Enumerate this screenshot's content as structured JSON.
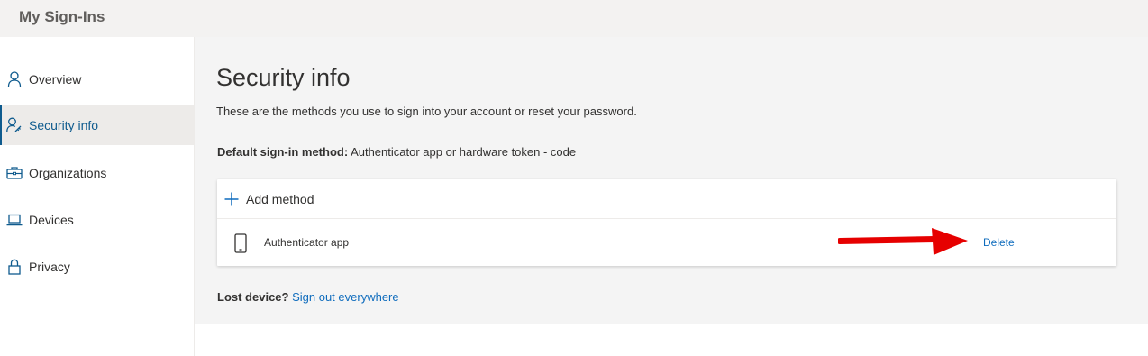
{
  "app": {
    "title": "My Sign-Ins"
  },
  "sidebar": {
    "items": [
      {
        "label": "Overview",
        "icon": "person-icon"
      },
      {
        "label": "Security info",
        "icon": "person-key-icon",
        "active": true
      },
      {
        "label": "Organizations",
        "icon": "briefcase-icon"
      },
      {
        "label": "Devices",
        "icon": "laptop-icon"
      },
      {
        "label": "Privacy",
        "icon": "lock-icon"
      }
    ]
  },
  "main": {
    "title": "Security info",
    "description": "These are the methods you use to sign into your account or reset your password.",
    "default_method": {
      "label": "Default sign-in method:",
      "value": " Authenticator app or hardware token - code"
    },
    "add_method_label": "Add method",
    "methods": [
      {
        "name": "Authenticator app",
        "icon": "phone-icon",
        "action": "Delete"
      }
    ],
    "lost_device": {
      "label": "Lost device?",
      "link": "Sign out everywhere"
    }
  },
  "colors": {
    "accent": "#0f6cbd",
    "nav_active": "#0f5b8e",
    "annotation_arrow": "#e60000",
    "topbar_bg": "#f3f2f1",
    "main_bg": "#f4f4f4"
  }
}
